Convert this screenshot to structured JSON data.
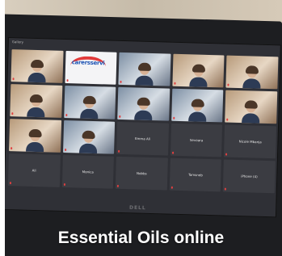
{
  "screen": {
    "title": "Gallery",
    "tiles": [
      {
        "kind": "video",
        "tone": "warm",
        "label": ""
      },
      {
        "kind": "logo",
        "logo_text": "carersservi",
        "label": ""
      },
      {
        "kind": "video",
        "tone": "cool",
        "label": ""
      },
      {
        "kind": "video",
        "tone": "warm",
        "label": ""
      },
      {
        "kind": "video",
        "tone": "warm",
        "label": ""
      },
      {
        "kind": "video",
        "tone": "warm",
        "label": ""
      },
      {
        "kind": "video",
        "tone": "cool",
        "label": ""
      },
      {
        "kind": "video",
        "tone": "cool",
        "label": ""
      },
      {
        "kind": "video",
        "tone": "cool",
        "label": ""
      },
      {
        "kind": "video",
        "tone": "warm",
        "label": ""
      },
      {
        "kind": "video",
        "tone": "warm",
        "label": ""
      },
      {
        "kind": "video",
        "tone": "cool",
        "label": ""
      },
      {
        "kind": "name",
        "name": "Emma Ali"
      },
      {
        "kind": "name",
        "name": "Sevoara"
      },
      {
        "kind": "name",
        "name": "Nicole Mbanja"
      },
      {
        "kind": "name",
        "name": "Ali"
      },
      {
        "kind": "name",
        "name": "Monica"
      },
      {
        "kind": "name",
        "name": "Nobbs"
      },
      {
        "kind": "name",
        "name": "Tamsneb"
      },
      {
        "kind": "name",
        "name": "iPhone (4)"
      }
    ]
  },
  "brand": "DELL",
  "caption": "Essential Oils online"
}
